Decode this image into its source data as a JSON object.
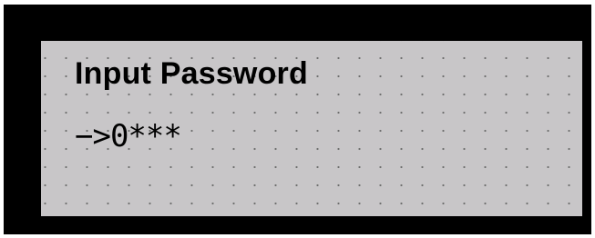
{
  "lcd": {
    "title": "Input Password",
    "input_line": "−>0***"
  },
  "colors": {
    "frame": "#000000",
    "screen_background": "#c8c6c8",
    "pixel_dot": "#6e6e6e",
    "text": "#000000"
  }
}
